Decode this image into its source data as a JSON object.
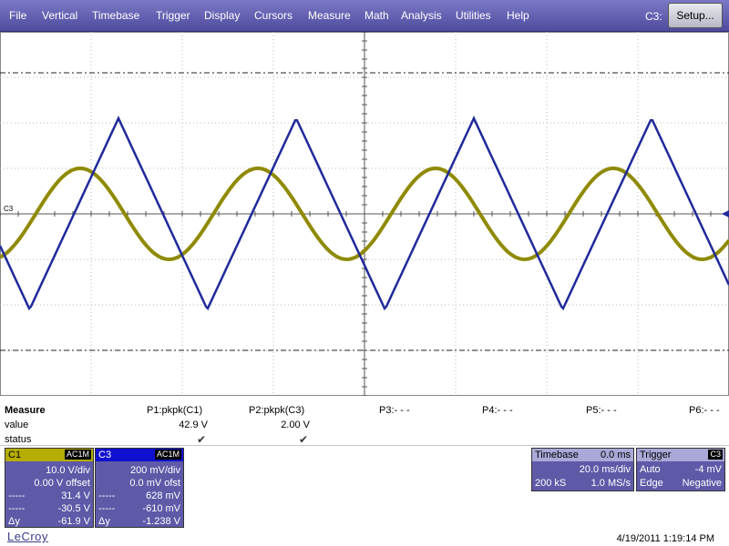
{
  "menu": {
    "items": [
      "File",
      "Vertical",
      "Timebase",
      "Trigger",
      "Display",
      "Cursors",
      "Measure",
      "Math",
      "Analysis",
      "Utilities",
      "Help"
    ],
    "channel": "C3:",
    "setup_label": "Setup..."
  },
  "grid": {
    "channel_marker": "C3",
    "colors": {
      "c1": "#8f8a00",
      "c3": "#1f2a9a",
      "grid": "#b9b9b9"
    }
  },
  "measure": {
    "title": "Measure",
    "row_value": "value",
    "row_status": "status",
    "columns": [
      {
        "label": "P1:pkpk(C1)",
        "value": "42.9 V",
        "status": "✔"
      },
      {
        "label": "P2:pkpk(C3)",
        "value": "2.00 V",
        "status": "✔"
      },
      {
        "label": "P3:- - -",
        "value": "",
        "status": ""
      },
      {
        "label": "P4:- - -",
        "value": "",
        "status": ""
      },
      {
        "label": "P5:- - -",
        "value": "",
        "status": ""
      },
      {
        "label": "P6:- - -",
        "value": "",
        "status": ""
      }
    ]
  },
  "channels": {
    "c1": {
      "name": "C1",
      "tag": "AC1M",
      "color": "#b5ad00",
      "rows": [
        {
          "l": "",
          "r": "10.0 V/div"
        },
        {
          "l": "",
          "r": "0.00 V offset"
        },
        {
          "l": "-----",
          "r": "31.4 V"
        },
        {
          "l": "-----",
          "r": "-30.5 V"
        },
        {
          "l": "Δy",
          "r": "-61.9 V"
        }
      ]
    },
    "c3": {
      "name": "C3",
      "tag": "AC1M",
      "color": "#1010d0",
      "rows": [
        {
          "l": "",
          "r": "200 mV/div"
        },
        {
          "l": "",
          "r": "0.0 mV ofst"
        },
        {
          "l": "-----",
          "r": "628 mV"
        },
        {
          "l": "-----",
          "r": "-610 mV"
        },
        {
          "l": "Δy",
          "r": "-1.238 V"
        }
      ]
    }
  },
  "timebase": {
    "label": "Timebase",
    "offset": "0.0 ms",
    "per_div": "20.0 ms/div",
    "samples": "200 kS",
    "rate": "1.0 MS/s"
  },
  "trigger": {
    "label": "Trigger",
    "tag": "C3",
    "mode": "Auto",
    "level": "-4 mV",
    "type": "Edge",
    "slope": "Negative"
  },
  "footer": {
    "logo": "LeCroy",
    "datetime": "4/19/2011 1:19:14 PM"
  },
  "waveforms": {
    "c1": {
      "amplitude_div": 1.0,
      "center_div": 0.0,
      "period_div": 1.95,
      "phase_div": 0.88
    },
    "c3": {
      "amplitude_div": 2.1,
      "center_div": 0.0,
      "period_div": 1.95,
      "phase_div": 1.3
    }
  }
}
